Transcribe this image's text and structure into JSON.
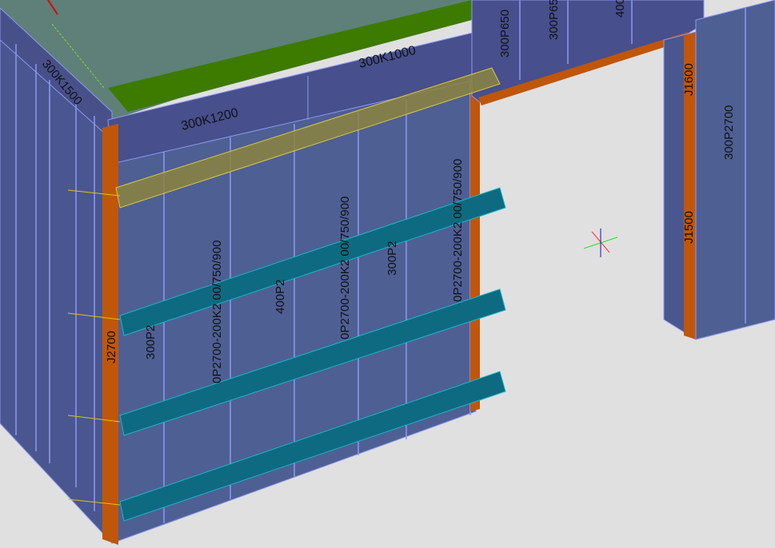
{
  "viewport": {
    "background": "#e0e0e0",
    "colors": {
      "panel_front": "#4e5f94",
      "panel_side": "#4a5690",
      "panel_edge": "#8c98f0",
      "slab": "#5e8078",
      "slab_edge": "#3d7a00",
      "corner": "#c0560a",
      "waler": "#0e6a80",
      "waler_edge": "#19b6cc",
      "top_waler": "#8c8440",
      "opening": "#e0e0e0"
    }
  },
  "labels": {
    "beam_top_left": "300K1200",
    "beam_top_right": "300K1000",
    "beam_left_side": "300K1500",
    "lintel_1": "300P650",
    "lintel_2": "300P65",
    "lintel_3": "400",
    "right_wall_panel": "300P2700",
    "corner_upper": "J1600",
    "corner_lower": "J1500",
    "corner_left": "J2700",
    "panel_a": "300P2",
    "panel_b": "0P2700-200K2 00/750/900",
    "panel_c": "400P2",
    "panel_d": "0P2700-200K2 00/750/900",
    "panel_e": "300P2",
    "panel_f": "0P2700-200K2 00/750/900"
  },
  "axis_gizmo": {
    "x_color": "#ff3030",
    "y_color": "#20e020",
    "z_color": "#1010c0"
  }
}
